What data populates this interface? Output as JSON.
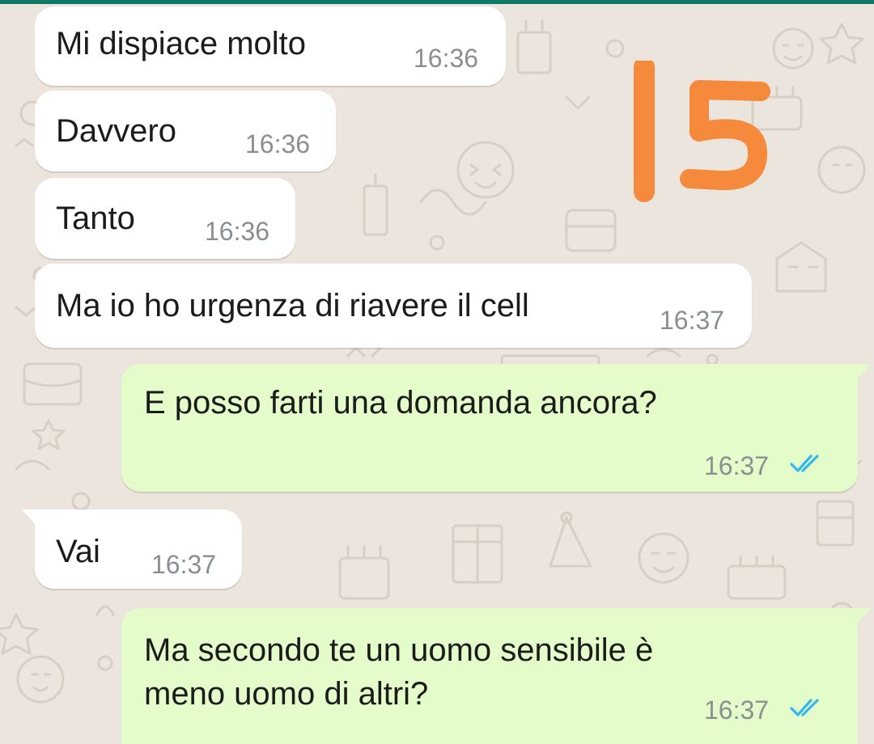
{
  "colors": {
    "incoming_bubble": "#ffffff",
    "outgoing_bubble": "#e3fcc9",
    "read_ticks": "#34b7f1",
    "overlay_number": "#f5893c"
  },
  "overlay": {
    "number": "15"
  },
  "messages": [
    {
      "direction": "incoming",
      "text": "Mi dispiace molto",
      "time": "16:36"
    },
    {
      "direction": "incoming",
      "text": "Davvero",
      "time": "16:36"
    },
    {
      "direction": "incoming",
      "text": "Tanto",
      "time": "16:36"
    },
    {
      "direction": "incoming",
      "text": "Ma io ho urgenza di riavere il cell",
      "time": "16:37"
    },
    {
      "direction": "outgoing",
      "text": "E posso farti una domanda ancora?",
      "time": "16:37",
      "status": "read",
      "status_icon": "double-check-icon"
    },
    {
      "direction": "incoming",
      "text": "Vai",
      "time": "16:37"
    },
    {
      "direction": "outgoing",
      "text_lines": [
        "Ma secondo te un uomo sensibile è",
        "meno uomo di altri?"
      ],
      "time": "16:37",
      "status": "read",
      "status_icon": "double-check-icon"
    }
  ]
}
